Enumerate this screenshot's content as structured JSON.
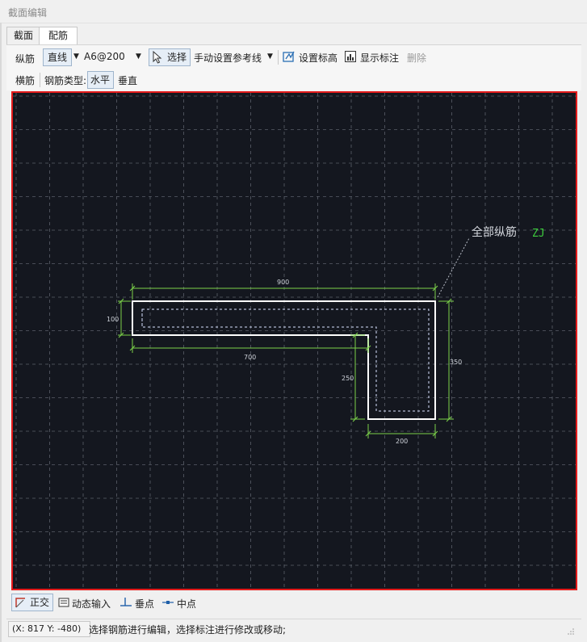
{
  "window": {
    "title": "截面编辑"
  },
  "tabs": [
    {
      "label": "截面",
      "active": false
    },
    {
      "label": "配筋",
      "active": true
    }
  ],
  "toolbar": {
    "longitudinal_label": "纵筋",
    "line_type": "直线",
    "rebar_spec": "A6@200",
    "select_label": "选择",
    "manual_ref_label": "手动设置参考线",
    "set_elevation_label": "设置标高",
    "show_annotation_label": "显示标注",
    "delete_label": "删除"
  },
  "toolbar2": {
    "transverse_label": "横筋",
    "rebar_type_label": "钢筋类型:",
    "horizontal_label": "水平",
    "vertical_label": "垂直"
  },
  "drawing": {
    "dims": {
      "top": "900",
      "left": "100",
      "bottom": "700",
      "stem": "250",
      "right": "350",
      "base": "200"
    },
    "callout_label": "全部纵筋",
    "callout_code": "ZJ",
    "colors": {
      "background": "#14171f",
      "grid": "#5a5f6a",
      "outline": "#ffffff",
      "dimension": "#7bd14a",
      "border": "#e41b1b",
      "code": "#3ecf3e"
    }
  },
  "snapbar": {
    "ortho_label": "正交",
    "dynamic_input_label": "动态输入",
    "perpendicular_label": "垂点",
    "midpoint_label": "中点"
  },
  "status": {
    "coords": "(X: 817 Y: -480)",
    "message": "选择钢筋进行编辑，选择标注进行修改或移动;"
  }
}
